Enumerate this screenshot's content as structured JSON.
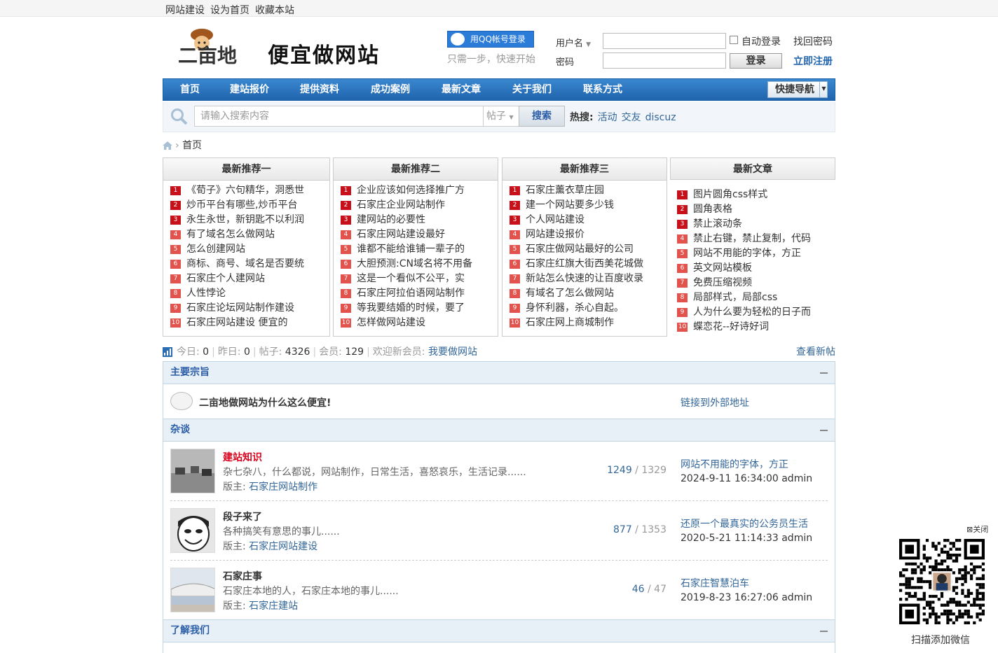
{
  "topbar": {
    "links": [
      "网站建设",
      "设为首页",
      "收藏本站"
    ]
  },
  "logo": {
    "brand": "二亩地",
    "slogan": "便宜做网站"
  },
  "qq_login": {
    "label": "用QQ帐号登录",
    "tip": "只需一步，快速开始"
  },
  "login": {
    "username_label": "用户名",
    "password_label": "密码",
    "auto_login": "自动登录",
    "submit": "登录",
    "forgot": "找回密码",
    "register": "立即注册"
  },
  "nav": {
    "items": [
      "首页",
      "建站报价",
      "提供资料",
      "成功案例",
      "最新文章",
      "关于我们",
      "联系方式"
    ],
    "quick": "快捷导航"
  },
  "search": {
    "placeholder": "请输入搜索内容",
    "type": "帖子",
    "button": "搜索",
    "hot_label": "热搜:",
    "hot": [
      "活动",
      "交友",
      "discuz"
    ]
  },
  "breadcrumb": {
    "home": "首页"
  },
  "columns": [
    {
      "title": "最新推荐一",
      "items": [
        "《荀子》六句精华，洞悉世",
        "炒币平台有哪些,炒币平台",
        "永生永世，新钥匙不以利润",
        "有了域名怎么做网站",
        "怎么创建网站",
        "商标、商号、域名是否要统",
        "石家庄个人建网站",
        "人性悖论",
        "石家庄论坛网站制作建设",
        "石家庄网站建设 便宜的"
      ]
    },
    {
      "title": "最新推荐二",
      "items": [
        "企业应该如何选择推广方",
        "石家庄企业网站制作",
        "建网站的必要性",
        "石家庄网站建设最好",
        "谁都不能给谁铺一辈子的",
        "大胆预测:CN域名将不用备",
        "这是一个看似不公平，实",
        "石家庄阿拉伯语网站制作",
        "等我要结婚的时候，要了",
        "怎样做网站建设"
      ]
    },
    {
      "title": "最新推荐三",
      "items": [
        "石家庄薰衣草庄园",
        "建一个网站要多少钱",
        "个人网站建设",
        "网站建设报价",
        "石家庄做网站最好的公司",
        "石家庄红旗大街西美花城做",
        "新站怎么快速的让百度收录",
        "有域名了怎么做网站",
        "身怀利器，杀心自起。",
        "石家庄网上商城制作"
      ]
    },
    {
      "title": "最新文章",
      "items": [
        "图片圆角css样式",
        "圆角表格",
        "禁止滚动条",
        "禁止右键，禁止复制，代码",
        "网站不用能的字体，方正",
        "英文网站模板",
        "免费压缩视频",
        "局部样式，局部css",
        "人为什么要为轻松的日子而",
        "蝶恋花--好诗好词"
      ]
    }
  ],
  "stats": {
    "today_label": "今日:",
    "today": "0",
    "yesterday_label": "昨日:",
    "yesterday": "0",
    "posts_label": "帖子:",
    "posts": "4326",
    "members_label": "会员:",
    "members": "129",
    "welcome_label": "欢迎新会员:",
    "welcome": "我要做网站",
    "new_posts": "查看新帖"
  },
  "sections": {
    "main": {
      "title": "主要宗旨",
      "forum_title": "二亩地做网站为什么这么便宜!",
      "forum_link": "链接到外部地址"
    },
    "talk": {
      "title": "杂谈",
      "forums": [
        {
          "title": "建站知识",
          "desc": "杂七杂八，什么都说，网站制作，日常生活，喜怒哀乐，生活记录......",
          "mod_label": "版主:",
          "mod": "石家庄网站制作",
          "threads": "1249",
          "posts": "1329",
          "last_title": "网站不用能的字体，方正",
          "last_date": "2024-9-11 16:34:00 admin"
        },
        {
          "title": "段子来了",
          "desc": "各种搞笑有意思的事儿......",
          "mod_label": "版主:",
          "mod": "石家庄网站建设",
          "threads": "877",
          "posts": "1353",
          "last_title": "还原一个最真实的公务员生活",
          "last_date": "2020-5-21 11:14:33 admin"
        },
        {
          "title": "石家庄事",
          "desc": "石家庄本地的人，石家庄本地的事儿......",
          "mod_label": "版主:",
          "mod": "石家庄建站",
          "threads": "46",
          "posts": "47",
          "last_title": "石家庄智慧泊车",
          "last_date": "2019-8-23 16:27:06 admin"
        }
      ]
    },
    "about": {
      "title": "了解我们"
    }
  },
  "qr": {
    "close": "⊠关闭",
    "caption": "扫描添加微信"
  },
  "colors": {
    "nav": "#1f64ad",
    "accent": "#336699",
    "badge": "#c8101a",
    "title_red": "#d9001b"
  }
}
